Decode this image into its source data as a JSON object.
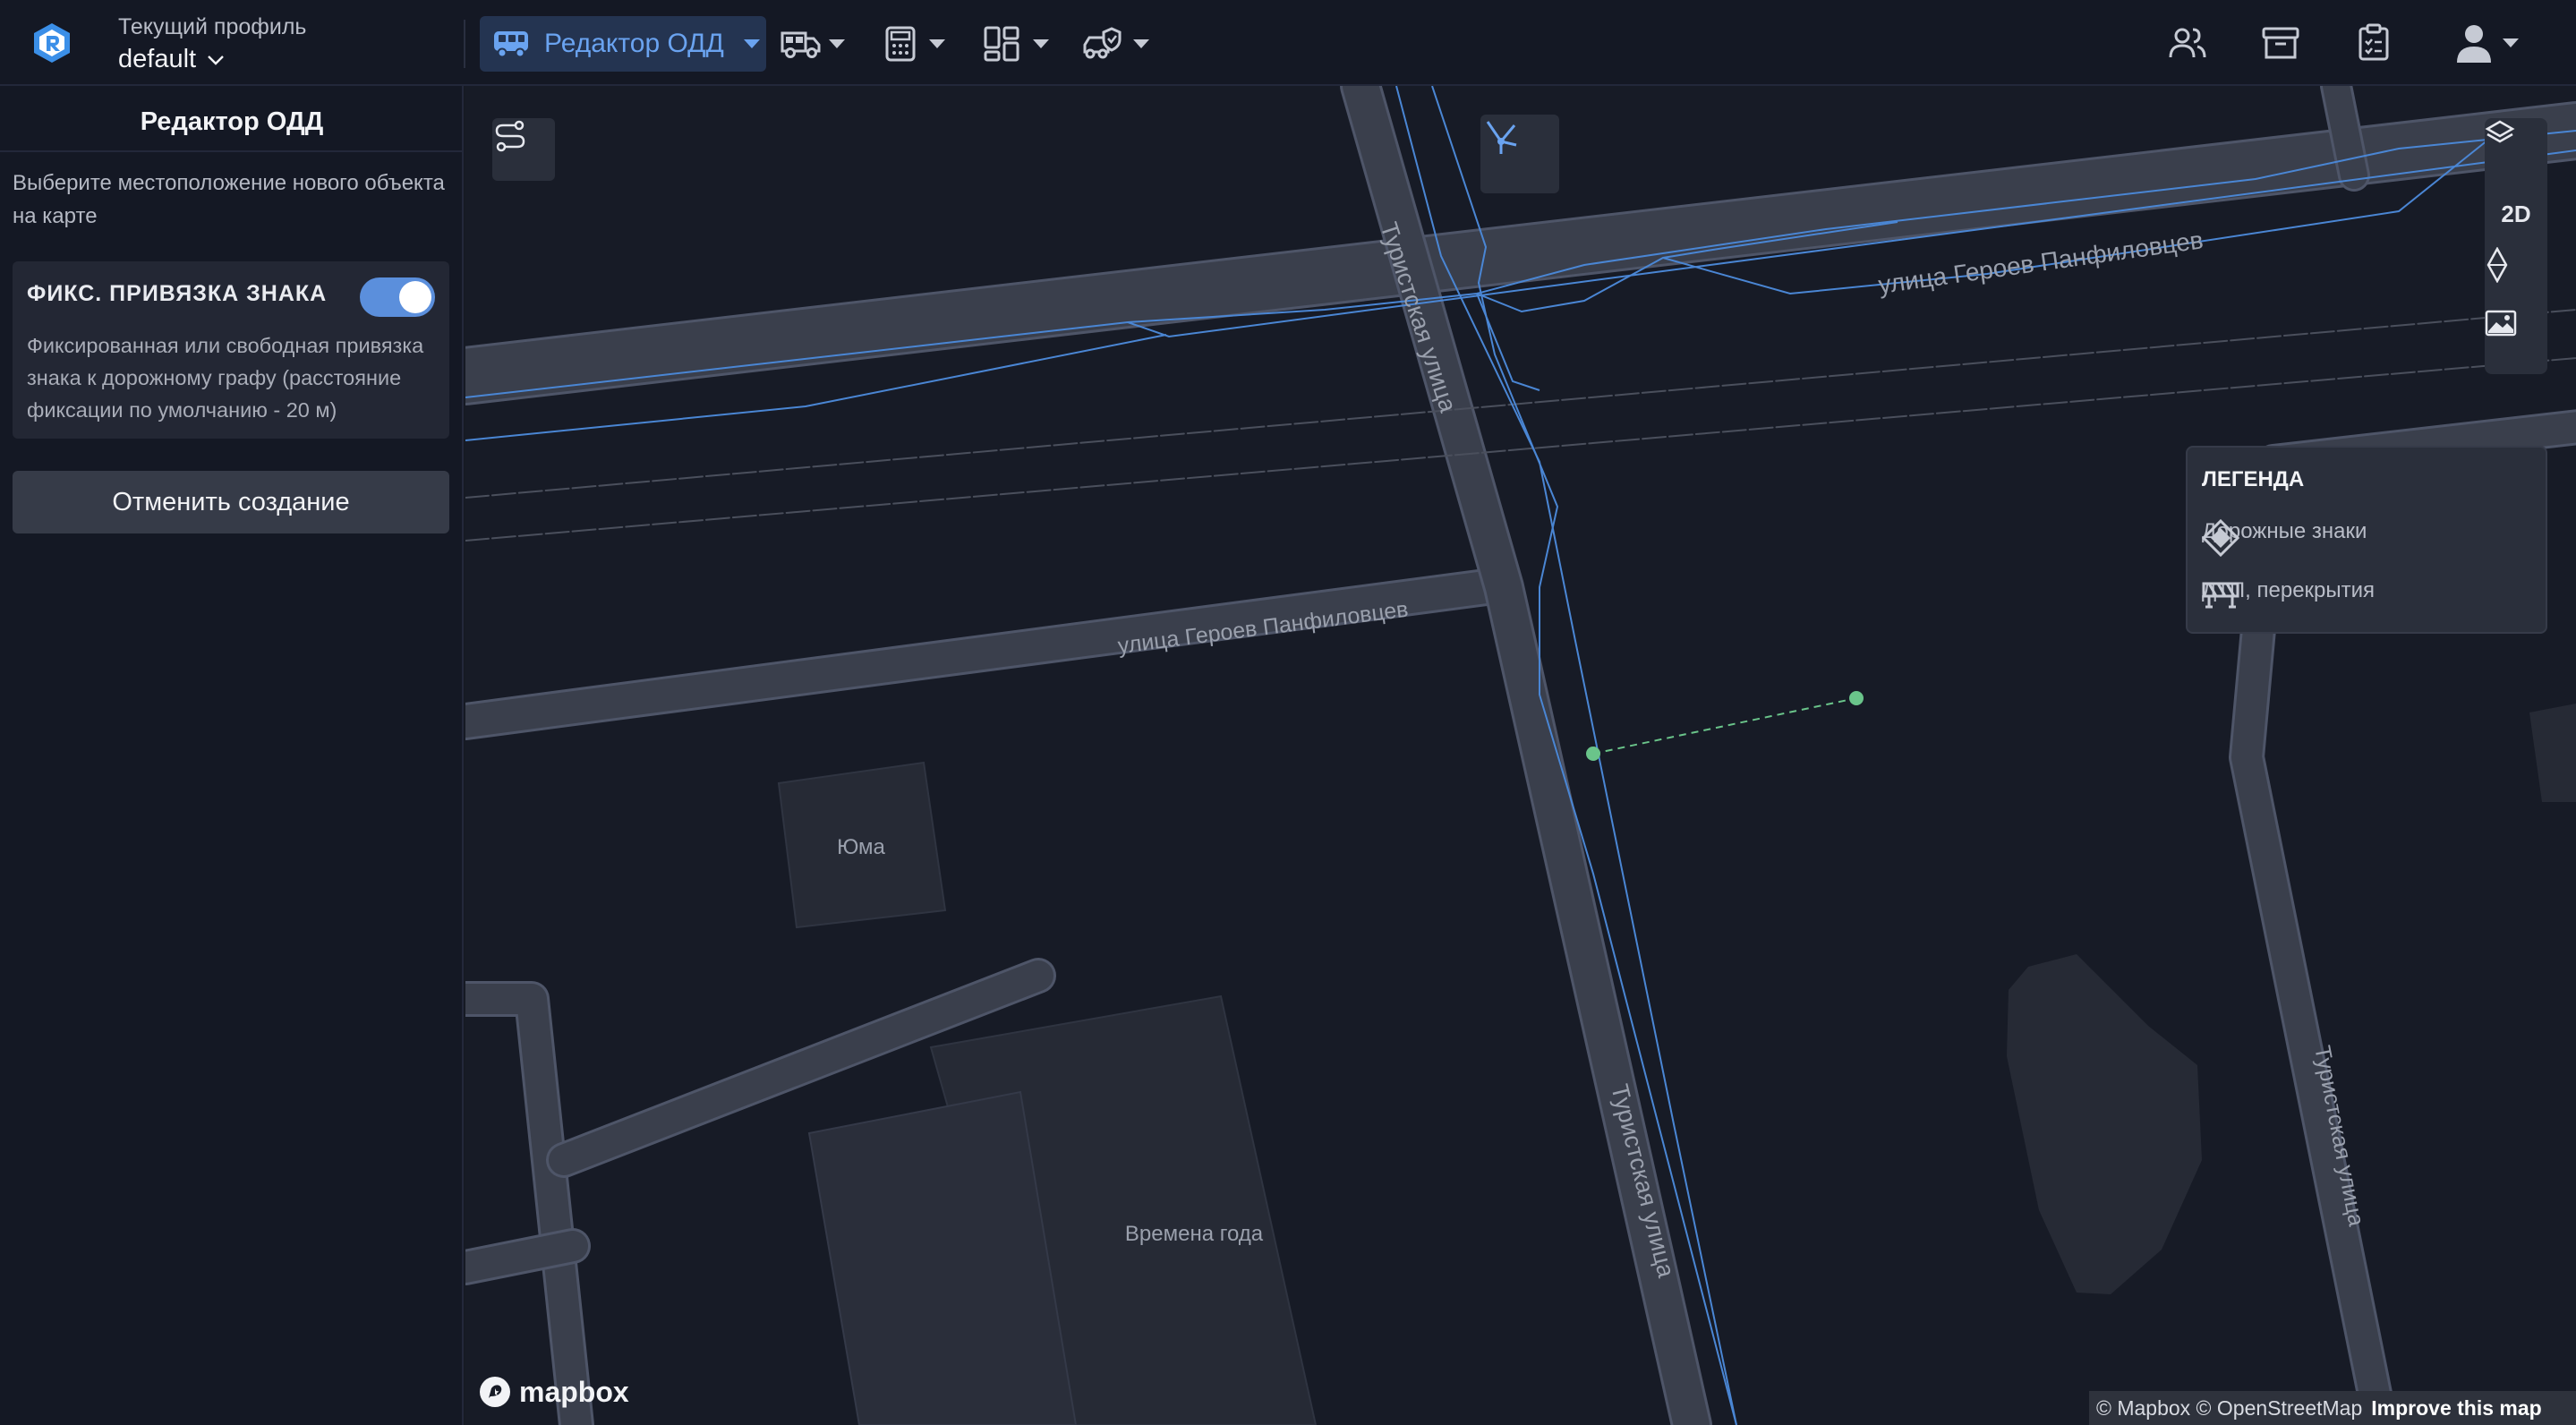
{
  "header": {
    "profile_label": "Текущий профиль",
    "profile_value": "default",
    "active_tool_label": "Редактор ОДД",
    "accent_color": "#6aa3f0"
  },
  "icons": {
    "logo": "app-logo-icon",
    "tools": [
      "bus-icon",
      "truck-icon",
      "calculator-icon",
      "dashboard-icon",
      "car-shield-icon"
    ],
    "right": [
      "users-icon",
      "archive-icon",
      "clipboard-icon",
      "user-avatar-icon"
    ]
  },
  "sidebar": {
    "title": "Редактор ОДД",
    "hint": "Выберите местоположение нового объекта на карте",
    "card": {
      "title": "ФИКС. ПРИВЯЗКА ЗНАКА",
      "toggle_on": true,
      "description": "Фиксированная или свободная привязка знака к дорожному графу (расстояние фиксации по умолчанию - 20 м)"
    },
    "cancel_label": "Отменить создание"
  },
  "map": {
    "street_labels": {
      "top": "улица Героев Панфиловцев",
      "middle": "улица Героев Панфиловцев",
      "turist_1": "Туристская улица",
      "turist_2": "Туристская улица",
      "turist_3": "Туристская улица"
    },
    "building_labels": {
      "yuma": "Юма",
      "vremena": "Времена года"
    },
    "controls": {
      "mode_2d": "2D"
    },
    "legend": {
      "title": "ЛЕГЕНДА",
      "items": [
        {
          "label": "Дорожные знаки",
          "icon": "road-sign-diamond-icon"
        },
        {
          "label": "ДТП, перекрытия",
          "icon": "roadblock-icon"
        }
      ]
    },
    "mapbox_logo": "mapbox",
    "attribution": {
      "text": "© Mapbox © OpenStreetMap",
      "link": "Improve this map"
    }
  }
}
